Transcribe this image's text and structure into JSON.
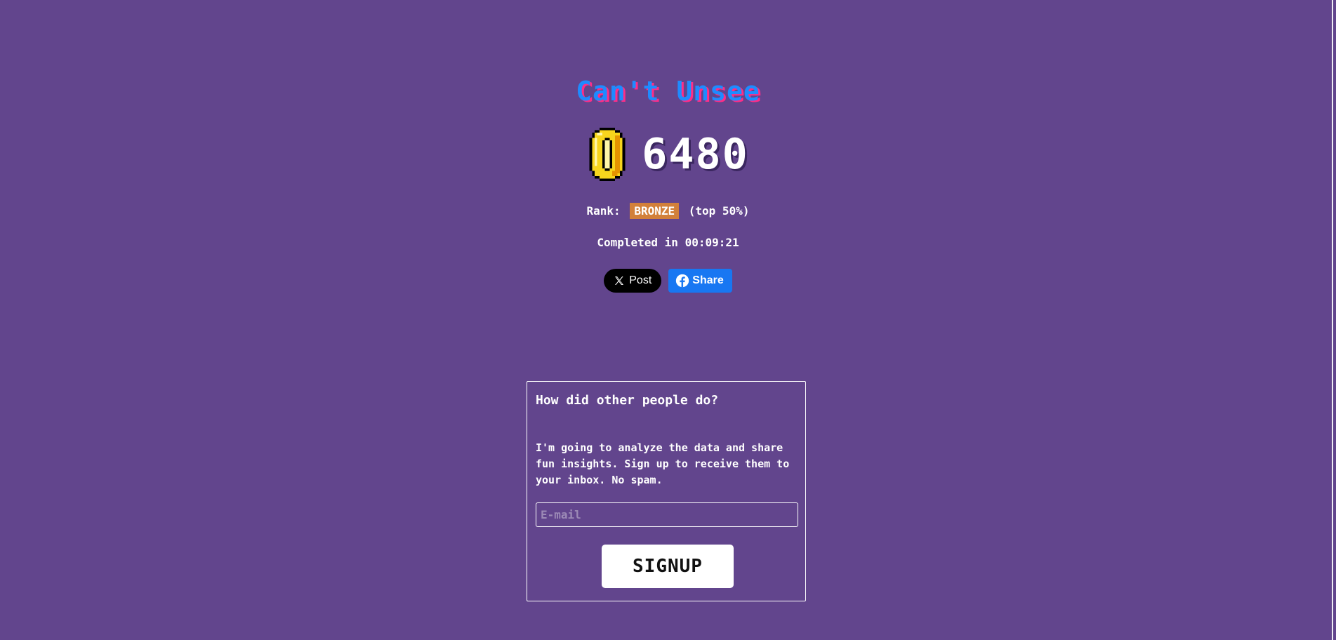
{
  "app": {
    "title": "Can't Unsee"
  },
  "result": {
    "coin_icon": "coin-icon",
    "score": "6480",
    "rank_label": "Rank:",
    "rank_value": "BRONZE",
    "rank_percentile": "(top 50%)",
    "completed_label": "Completed in",
    "completed_time": "00:09:21"
  },
  "share": {
    "x_label": "Post",
    "x_icon": "x-logo-icon",
    "facebook_label": "Share",
    "facebook_icon": "facebook-logo-icon"
  },
  "signup": {
    "heading": "How did other people do?",
    "description": "I'm going to analyze the data and share fun insights. Sign up to receive them to your inbox. No spam.",
    "email_placeholder": "E-mail",
    "email_value": "",
    "button_label": "SIGNUP"
  },
  "colors": {
    "background": "#62458d",
    "title_primary": "#1e8bff",
    "title_shadow": "#ff2d87",
    "rank_badge": "#d2803a",
    "facebook_blue": "#1877f2"
  }
}
